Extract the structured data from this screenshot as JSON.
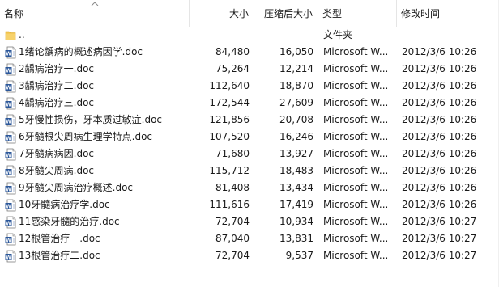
{
  "columns": {
    "name": "名称",
    "size": "大小",
    "compressed": "压缩后大小",
    "type": "类型",
    "modified": "修改时间"
  },
  "files": [
    {
      "name": "..",
      "size": "",
      "compressed": "",
      "type": "文件夹",
      "modified": "",
      "icon": "folder-icon"
    },
    {
      "name": "1绪论龋病的概述病因学.doc",
      "size": "84,480",
      "compressed": "16,050",
      "type": "Microsoft W...",
      "modified": "2012/3/6 10:26",
      "icon": "word-doc-icon"
    },
    {
      "name": "2龋病治疗一.doc",
      "size": "75,264",
      "compressed": "12,214",
      "type": "Microsoft W...",
      "modified": "2012/3/6 10:26",
      "icon": "word-doc-icon"
    },
    {
      "name": "3龋病治疗二.doc",
      "size": "112,640",
      "compressed": "18,870",
      "type": "Microsoft W...",
      "modified": "2012/3/6 10:26",
      "icon": "word-doc-icon"
    },
    {
      "name": "4龋病治疗三.doc",
      "size": "172,544",
      "compressed": "27,609",
      "type": "Microsoft W...",
      "modified": "2012/3/6 10:26",
      "icon": "word-doc-icon"
    },
    {
      "name": "5牙慢性损伤，牙本质过敏症.doc",
      "size": "121,856",
      "compressed": "20,708",
      "type": "Microsoft W...",
      "modified": "2012/3/6 10:26",
      "icon": "word-doc-icon"
    },
    {
      "name": "6牙髓根尖周病生理学特点.doc",
      "size": "107,520",
      "compressed": "16,246",
      "type": "Microsoft W...",
      "modified": "2012/3/6 10:26",
      "icon": "word-doc-icon"
    },
    {
      "name": "7牙髓病病因.doc",
      "size": "71,680",
      "compressed": "13,927",
      "type": "Microsoft W...",
      "modified": "2012/3/6 10:26",
      "icon": "word-doc-icon"
    },
    {
      "name": "8牙髓尖周病.doc",
      "size": "115,712",
      "compressed": "18,483",
      "type": "Microsoft W...",
      "modified": "2012/3/6 10:26",
      "icon": "word-doc-icon"
    },
    {
      "name": "9牙髓尖周病治疗概述.doc",
      "size": "81,408",
      "compressed": "13,434",
      "type": "Microsoft W...",
      "modified": "2012/3/6 10:26",
      "icon": "word-doc-icon"
    },
    {
      "name": "10牙髓病治疗学.doc",
      "size": "111,616",
      "compressed": "17,419",
      "type": "Microsoft W...",
      "modified": "2012/3/6 10:26",
      "icon": "word-doc-icon"
    },
    {
      "name": "11感染牙髓的治疗.doc",
      "size": "72,704",
      "compressed": "10,934",
      "type": "Microsoft W...",
      "modified": "2012/3/6 10:27",
      "icon": "word-doc-icon"
    },
    {
      "name": "12根管治疗一.doc",
      "size": "87,040",
      "compressed": "13,831",
      "type": "Microsoft W...",
      "modified": "2012/3/6 10:27",
      "icon": "word-doc-icon"
    },
    {
      "name": "13根管治疗二.doc",
      "size": "72,704",
      "compressed": "9,537",
      "type": "Microsoft W...",
      "modified": "2012/3/6 10:27",
      "icon": "word-doc-icon"
    }
  ],
  "colors": {
    "folder": "#f0c24a",
    "word_blue": "#2b579a",
    "separator": "#e5e5e5"
  }
}
